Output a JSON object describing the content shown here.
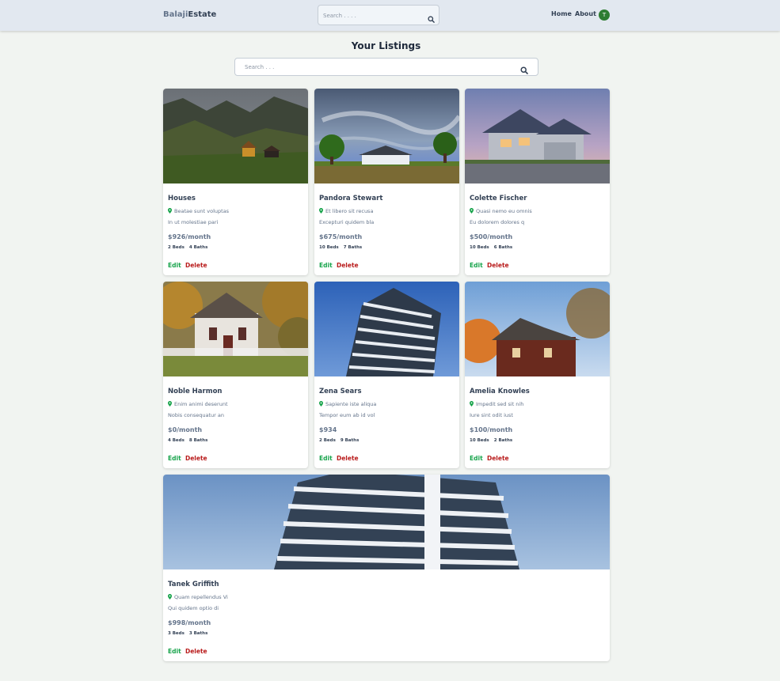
{
  "header": {
    "logo_part1": "Balaji",
    "logo_part2": "Estate",
    "search_placeholder": "Search . . . .",
    "nav_home": "Home",
    "nav_about": "About",
    "avatar_initial": "T"
  },
  "main": {
    "title": "Your Listings",
    "search_placeholder": "Search . . ."
  },
  "actions": {
    "edit": "Edit",
    "delete": "Delete"
  },
  "colors": {
    "accent_green": "#16a34a",
    "delete_red": "#b91c1c",
    "avatar_bg": "#2e7d32"
  },
  "listings": [
    {
      "name": "Houses",
      "address": "Beatae sunt voluptas",
      "description": "In ut molestiae pari",
      "price": "$926/month",
      "beds": "2 Beds",
      "baths": "4 Baths",
      "image": "mountain-farmhouse-photo"
    },
    {
      "name": "Pandora Stewart",
      "address": "Et libero sit recusa",
      "description": "Excepturi quidem bla",
      "price": "$675/month",
      "beds": "10 Beds",
      "baths": "7 Baths",
      "image": "white-mansion-stormy-sky-photo"
    },
    {
      "name": "Colette Fischer",
      "address": "Quasi nemo eu omnis",
      "description": "Eu dolorem dolores q",
      "price": "$500/month",
      "beds": "10 Beds",
      "baths": "6 Baths",
      "image": "suburban-house-dusk-photo"
    },
    {
      "name": "Noble Harmon",
      "address": "Enim animi deserunt",
      "description": "Nobis consequatur an",
      "price": "$0/month",
      "beds": "4 Beds",
      "baths": "8 Baths",
      "image": "white-cottage-autumn-photo"
    },
    {
      "name": "Zena Sears",
      "address": "Sapiente iste aliqua",
      "description": "Tempor eum ab id vol",
      "price": "$934",
      "beds": "2 Beds",
      "baths": "9 Baths",
      "image": "modern-apartment-tower-photo"
    },
    {
      "name": "Amelia Knowles",
      "address": "Impedit sed sit nih",
      "description": "Iure sint odit iust",
      "price": "$100/month",
      "beds": "10 Beds",
      "baths": "2 Baths",
      "image": "brick-house-autumn-trees-photo"
    },
    {
      "name": "Tanek Griffith",
      "address": "Quam repellendus Vi",
      "description": "Qui quidem optio di",
      "price": "$998/month",
      "beds": "3 Beds",
      "baths": "3 Baths",
      "image": "modern-highrise-balconies-photo"
    }
  ]
}
